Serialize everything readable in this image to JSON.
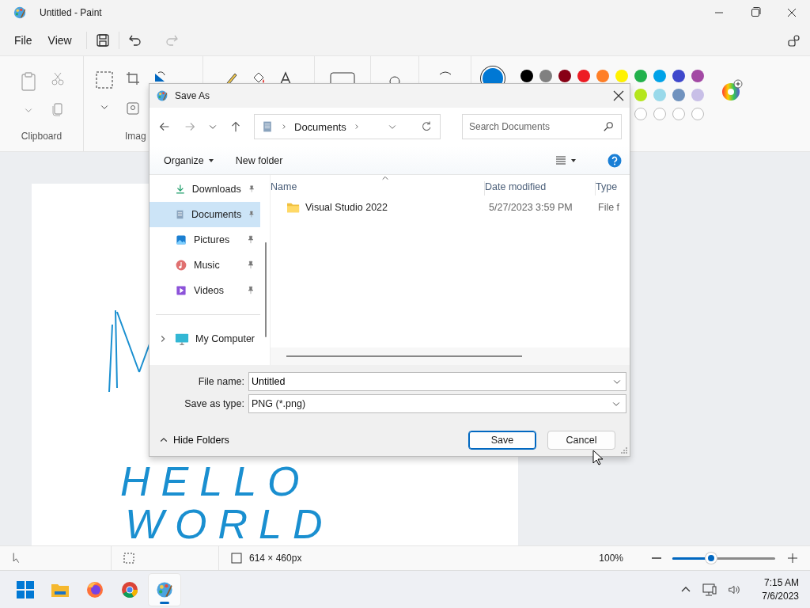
{
  "window": {
    "title": "Untitled - Paint"
  },
  "menu": [
    {
      "label": "File"
    },
    {
      "label": "View"
    }
  ],
  "ribbon": {
    "groups": [
      {
        "label": "Clipboard"
      },
      {
        "label": "Imag"
      }
    ],
    "palette": [
      {
        "color": "#000000"
      },
      {
        "color": "#808080"
      },
      {
        "color": "#880015"
      },
      {
        "color": "#ed1c24"
      },
      {
        "color": "#ff7f27"
      },
      {
        "color": "#fff200"
      },
      {
        "color": "#22b14c"
      },
      {
        "color": "#00a2e8"
      },
      {
        "color": "#3f48cc"
      },
      {
        "color": "#a349a4"
      },
      {
        "color": "#b5e61d"
      },
      {
        "color": "#99d9ea"
      },
      {
        "color": "#7092be"
      },
      {
        "color": "#c8bfe7"
      }
    ]
  },
  "canvas_text": [
    "HELLO",
    "WORLD"
  ],
  "status_bar": {
    "canvas_size": "614 × 460px",
    "zoom": "100%",
    "zoom_slider": {
      "level": 0.38
    }
  },
  "dialog": {
    "title": "Save As",
    "breadcrumb": [
      "Documents"
    ],
    "search": {
      "placeholder": "Search Documents"
    },
    "commands": [
      "Organize",
      "New folder"
    ],
    "nav": [
      {
        "label": "Downloads",
        "kind": "downloads",
        "pinned": true,
        "selected": false
      },
      {
        "label": "Documents",
        "kind": "documents",
        "pinned": true,
        "selected": true
      },
      {
        "label": "Pictures",
        "kind": "pictures",
        "pinned": true,
        "selected": false
      },
      {
        "label": "Music",
        "kind": "music",
        "pinned": true,
        "selected": false
      },
      {
        "label": "Videos",
        "kind": "videos",
        "pinned": true,
        "selected": false
      }
    ],
    "tree": [
      {
        "label": "My Computer",
        "expanded": false
      }
    ],
    "columns": [
      "Name",
      "Date modified",
      "Type"
    ],
    "files": [
      {
        "name": "Visual Studio 2022",
        "date": "5/27/2023 3:59 PM",
        "type": "File f",
        "selected": false
      }
    ],
    "file_name_label": "File name:",
    "file_name": "Untitled",
    "type_label": "Save as type:",
    "save_type": "PNG (*.png)",
    "hide_folders": "Hide Folders",
    "buttons": [
      {
        "label": "Save",
        "kind": "primary"
      },
      {
        "label": "Cancel",
        "kind": "secondary"
      }
    ]
  },
  "taskbar": {
    "apps": [
      {
        "kind": "start",
        "selected": false
      },
      {
        "kind": "explorer",
        "selected": false
      },
      {
        "kind": "firefox",
        "selected": false
      },
      {
        "kind": "chrome",
        "selected": false
      },
      {
        "kind": "paint",
        "selected": true
      }
    ],
    "time": "7:15 AM",
    "date": "7/6/2023"
  }
}
